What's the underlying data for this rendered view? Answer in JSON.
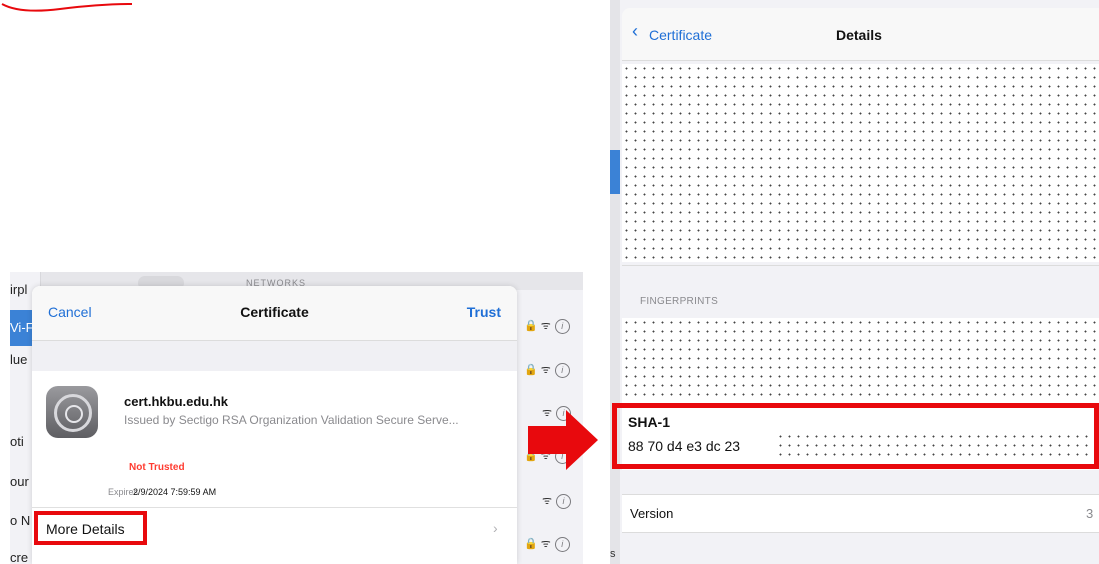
{
  "left": {
    "background_sidebar": [
      "irpl",
      "Vi-F",
      "lue",
      "",
      "oti",
      "our",
      "o N",
      "cre"
    ],
    "networks_header": "NETWORKS",
    "sheet": {
      "cancel": "Cancel",
      "title": "Certificate",
      "trust": "Trust",
      "cert_name": "cert.hkbu.edu.hk",
      "issuer": "Issued by Sectigo RSA Organization Validation Secure Serve...",
      "status": "Not Trusted",
      "expires_label": "Expires",
      "expires_value": "2/9/2024 7:59:59 AM",
      "more_details": "More Details",
      "chevron": "›"
    },
    "network_rows": [
      {
        "icons": "🔒 ᯤ",
        "info": "i"
      },
      {
        "icons": "🔒 ᯤ",
        "info": "i"
      },
      {
        "icons": "ᯤ",
        "info": "i"
      },
      {
        "icons": "🔒 ᯤ",
        "info": "i"
      },
      {
        "icons": "ᯤ",
        "info": "i"
      },
      {
        "icons": "ᯤ",
        "info": "i"
      },
      {
        "icons": "🔒 ᯤ",
        "info": "i"
      }
    ]
  },
  "right": {
    "back_label": "Certificate",
    "title": "Details",
    "fingerprints_header": "FINGERPRINTS",
    "sha1_label": "SHA-1",
    "sha1_value": "88 70 d4 e3 dc 23",
    "version_label": "Version",
    "version_value": "3",
    "edge_char": "s"
  },
  "colors": {
    "highlight_red": "#e8090d",
    "ios_blue": "#1f6fd6",
    "warning_red": "#ff3b30"
  }
}
